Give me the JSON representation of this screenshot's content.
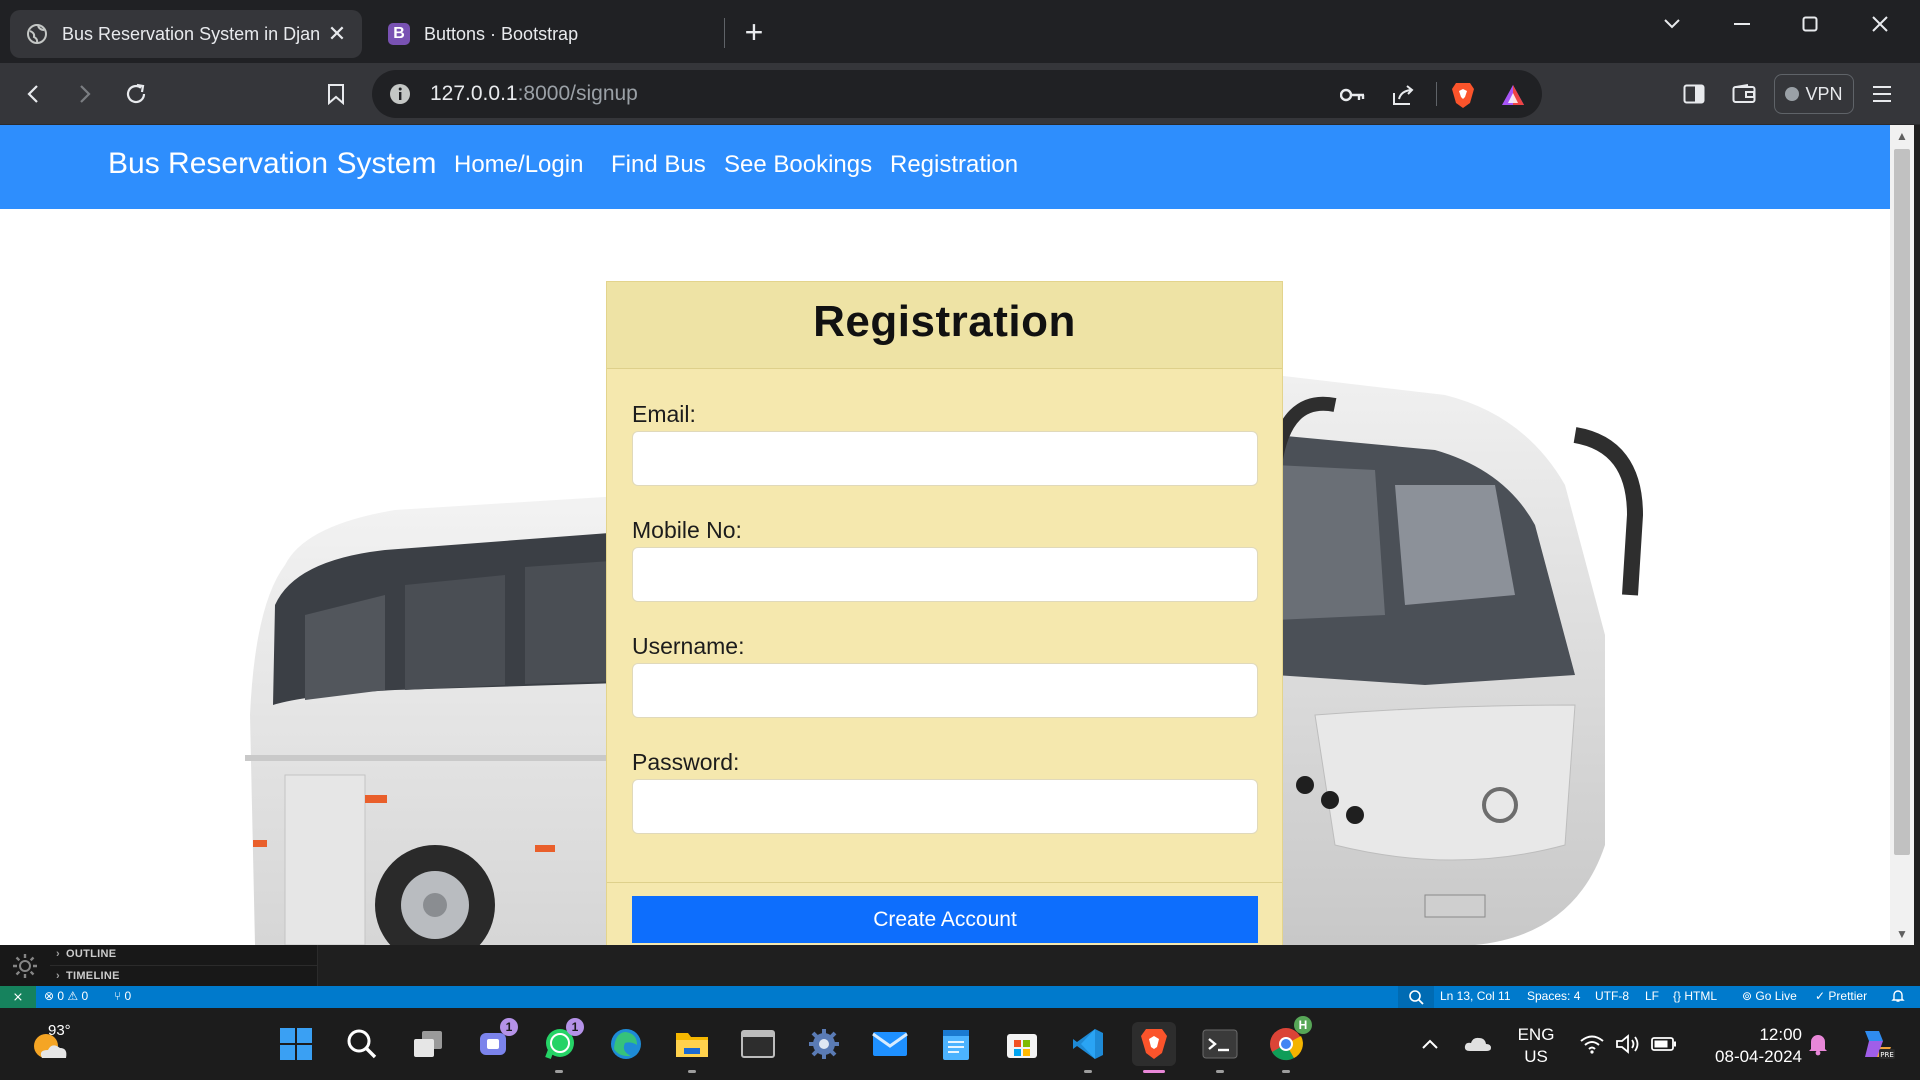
{
  "browser": {
    "tabs": [
      {
        "title": "Bus Reservation System in Djang",
        "active": true
      },
      {
        "title": "Buttons · Bootstrap",
        "active": false
      }
    ],
    "url_host": "127.0.0.1",
    "url_path": ":8000/signup",
    "vpn_label": "VPN"
  },
  "site": {
    "brand": "Bus Reservation System",
    "nav": [
      "Home/Login",
      "Find Bus",
      "See Bookings",
      "Registration"
    ],
    "nav_color": "#2e8efd"
  },
  "form": {
    "title": "Registration",
    "fields": [
      {
        "label": "Email:",
        "value": ""
      },
      {
        "label": "Mobile No:",
        "value": ""
      },
      {
        "label": "Username:",
        "value": ""
      },
      {
        "label": "Password:",
        "value": ""
      }
    ],
    "submit_label": "Create Account",
    "card_color": "#f5e8ae",
    "button_color": "#0d6efd"
  },
  "vscode": {
    "panels": [
      "OUTLINE",
      "TIMELINE"
    ],
    "status": {
      "problems": "⊗ 0 ⚠ 0",
      "ports": "⑂ 0",
      "cursor": "Ln 13, Col 11",
      "spaces": "Spaces: 4",
      "encoding": "UTF-8",
      "eol": "LF",
      "language": "{} HTML",
      "golive": "Go Live",
      "prettier": "✓ Prettier"
    }
  },
  "taskbar": {
    "temperature": "93°",
    "lang_line1": "ENG",
    "lang_line2": "US",
    "time": "12:00",
    "date": "08-04-2024",
    "badges": {
      "teams": "1",
      "whatsapp": "1",
      "chrome": "H"
    }
  }
}
